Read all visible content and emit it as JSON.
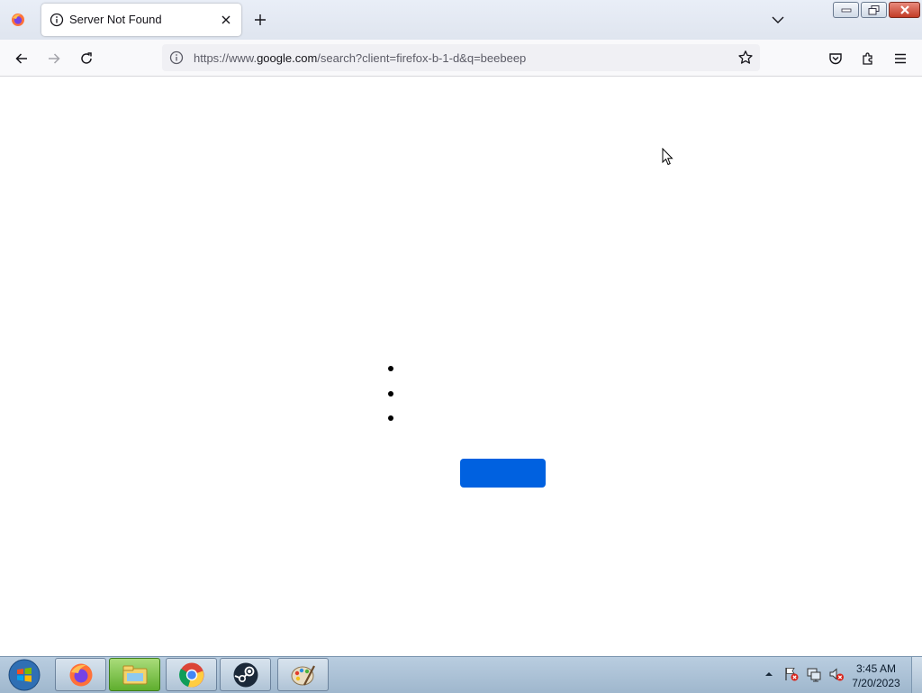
{
  "browser": {
    "tab": {
      "title": "Server Not Found",
      "close_icon": "close-icon",
      "status_icon": "info-icon"
    },
    "new_tab_icon": "plus-icon",
    "tab_list_icon": "chevron-down-icon",
    "window_controls": [
      "minimize",
      "maximize",
      "close"
    ]
  },
  "navbar": {
    "back_icon": "back-arrow-icon",
    "forward_icon": "forward-arrow-icon",
    "reload_icon": "reload-icon",
    "url": {
      "prefix": "https://www.",
      "host": "google.com",
      "suffix": "/search?client=firefox-b-1-d&q=beebeep"
    },
    "bookmark_icon": "star-icon",
    "right_icons": [
      "pocket-icon",
      "extensions-icon",
      "menu-icon"
    ]
  },
  "content": {
    "bullets": [
      "",
      "",
      ""
    ],
    "button_label": "",
    "button_color": "#0061e0"
  },
  "taskbar": {
    "pinned": [
      "firefox-icon",
      "file-manager-icon",
      "chrome-icon",
      "steam-icon",
      "paint-icon"
    ],
    "tray_icons": [
      "show-hidden-icons-icon",
      "action-center-flag-icon",
      "network-icon",
      "volume-muted-icon"
    ],
    "clock": {
      "time": "3:45 AM",
      "date": "7/20/2023"
    }
  }
}
